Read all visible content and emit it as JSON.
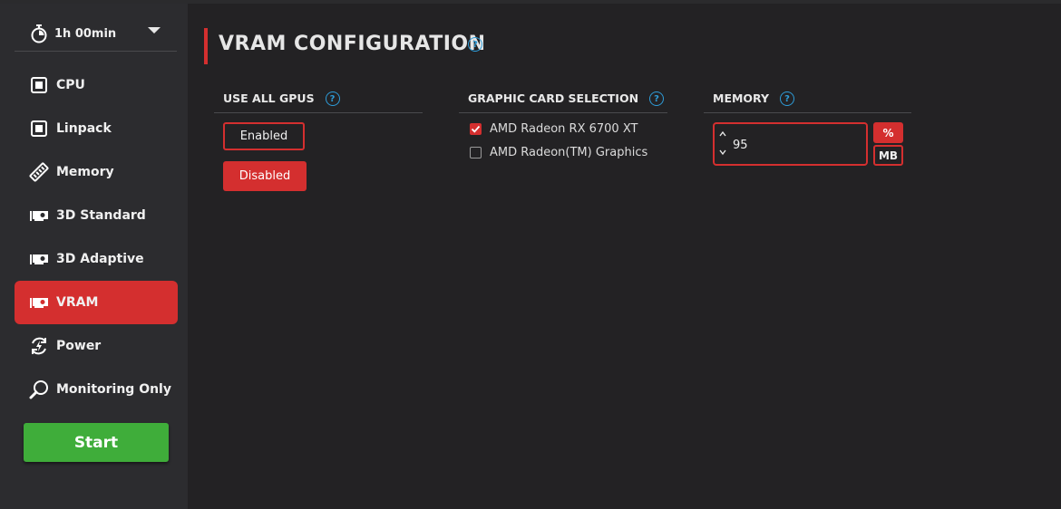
{
  "colors": {
    "accent": "#d42f2f",
    "start": "#3fad3a",
    "help": "#2e9cd8",
    "sidebar_bg": "#2c2c2f",
    "main_bg": "#232224"
  },
  "timer": {
    "label": "1h 00min",
    "icon": "stopwatch-icon"
  },
  "nav": [
    {
      "label": "CPU",
      "icon": "cpu-icon",
      "active": false
    },
    {
      "label": "Linpack",
      "icon": "cpu-icon",
      "active": false
    },
    {
      "label": "Memory",
      "icon": "memory-stick-icon",
      "active": false
    },
    {
      "label": "3D Standard",
      "icon": "gpu-icon",
      "active": false
    },
    {
      "label": "3D Adaptive",
      "icon": "gpu-icon",
      "active": false
    },
    {
      "label": "VRAM",
      "icon": "gpu-icon",
      "active": true
    },
    {
      "label": "Power",
      "icon": "power-cycle-icon",
      "active": false
    },
    {
      "label": "Monitoring Only",
      "icon": "magnifier-icon",
      "active": false
    }
  ],
  "start_label": "Start",
  "page_title": "VRAM CONFIGURATION",
  "use_all_gpus": {
    "heading": "USE ALL GPUS",
    "enabled_label": "Enabled",
    "disabled_label": "Disabled",
    "selected": "Disabled"
  },
  "gpu_selection": {
    "heading": "GRAPHIC CARD SELECTION",
    "cards": [
      {
        "name": "AMD Radeon RX 6700 XT",
        "checked": true
      },
      {
        "name": "AMD Radeon(TM) Graphics",
        "checked": false
      }
    ]
  },
  "memory": {
    "heading": "MEMORY",
    "value": "95",
    "unit_percent": "%",
    "unit_mb": "MB",
    "selected_unit": "%"
  },
  "help_glyph": "?"
}
